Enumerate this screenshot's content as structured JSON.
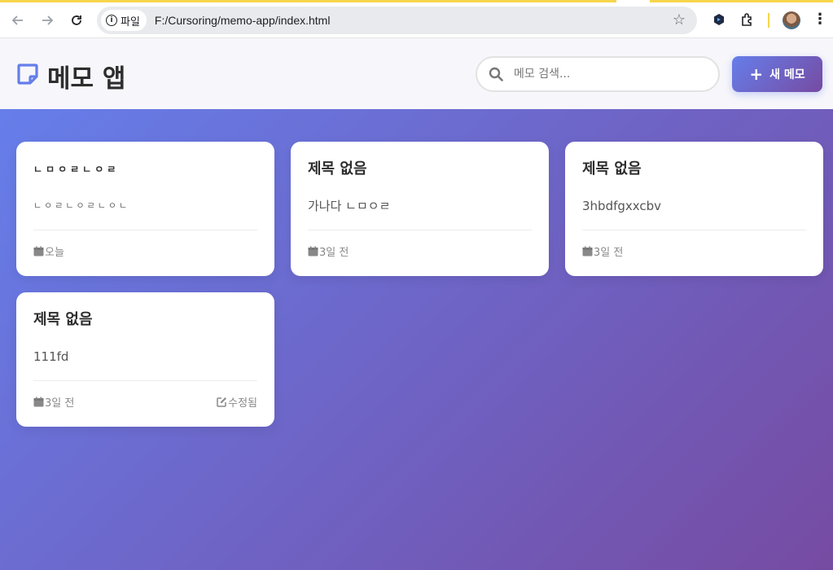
{
  "browser": {
    "chip_label": "파일",
    "url": "F:/Cursoring/memo-app/index.html"
  },
  "header": {
    "title": "메모 앱",
    "search_placeholder": "메모 검색...",
    "new_button_label": "새 메모"
  },
  "colors": {
    "accent_start": "#667eea",
    "accent_end": "#764ba2"
  },
  "memos": [
    {
      "title": "ㄴㅁㅇㄹㄴㅇㄹ",
      "body": "ㄴㅇㄹㄴㅇㄹㄴㅇㄴ",
      "date": "오늘",
      "edited": ""
    },
    {
      "title": "제목 없음",
      "body": "가나다 ㄴㅁㅇㄹ",
      "date": "3일 전",
      "edited": ""
    },
    {
      "title": "제목 없음",
      "body": "3hbdfgxxcbv",
      "date": "3일 전",
      "edited": ""
    },
    {
      "title": "제목 없음",
      "body": "111fd",
      "date": "3일 전",
      "edited": "수정됨"
    }
  ]
}
